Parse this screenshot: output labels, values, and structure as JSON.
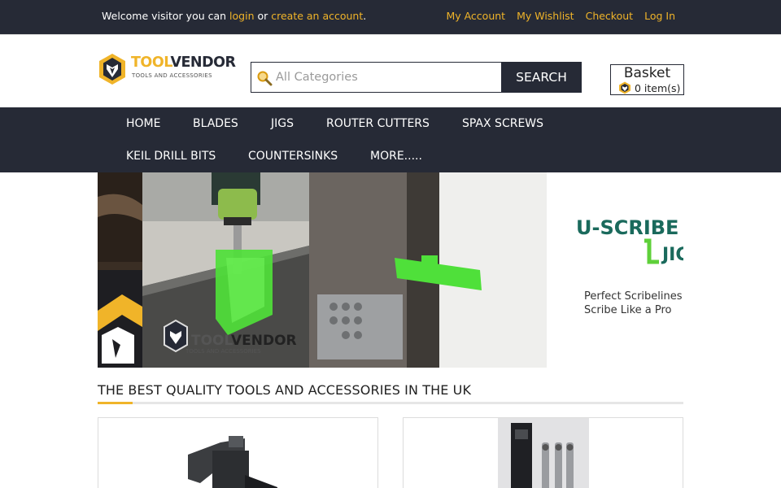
{
  "topbar": {
    "welcome_prefix": "Welcome visitor you can ",
    "login_label": "login",
    "or_text": " or ",
    "create_account_label": "create an account",
    "period": ".",
    "links": [
      "My Account",
      "My Wishlist",
      "Checkout",
      "Log In"
    ]
  },
  "logo": {
    "brand_part1": "TOOL",
    "brand_part2": "VENDOR",
    "tagline": "TOOLS AND ACCESSORIES"
  },
  "search": {
    "placeholder": "All Categories",
    "button_label": "SEARCH"
  },
  "basket": {
    "title": "Basket",
    "count_text": "0 item(s)"
  },
  "nav": {
    "items": [
      "HOME",
      "BLADES",
      "JIGS",
      "ROUTER CUTTERS",
      "SPAX SCREWS",
      "KEIL DRILL BITS",
      "COUNTERSINKS",
      "MORE....."
    ]
  },
  "banner": {
    "logo_part1": "TOOL",
    "logo_part2": "VENDOR",
    "logo_tagline": "TOOLS AND ACCESSORIES",
    "product_name_line1": "U-SCRIBE",
    "product_name_line2": "JIG",
    "slogan_line1": "Perfect Scribelines",
    "slogan_line2": "Scribe Like a Pro"
  },
  "section": {
    "title": "THE BEST QUALITY TOOLS AND ACCESSORIES IN THE UK"
  },
  "colors": {
    "dark": "#262a36",
    "accent": "#f0b429",
    "jig_green": "#4fe03a"
  },
  "icons": [
    "search-icon",
    "basket-icon",
    "logo-mark"
  ]
}
